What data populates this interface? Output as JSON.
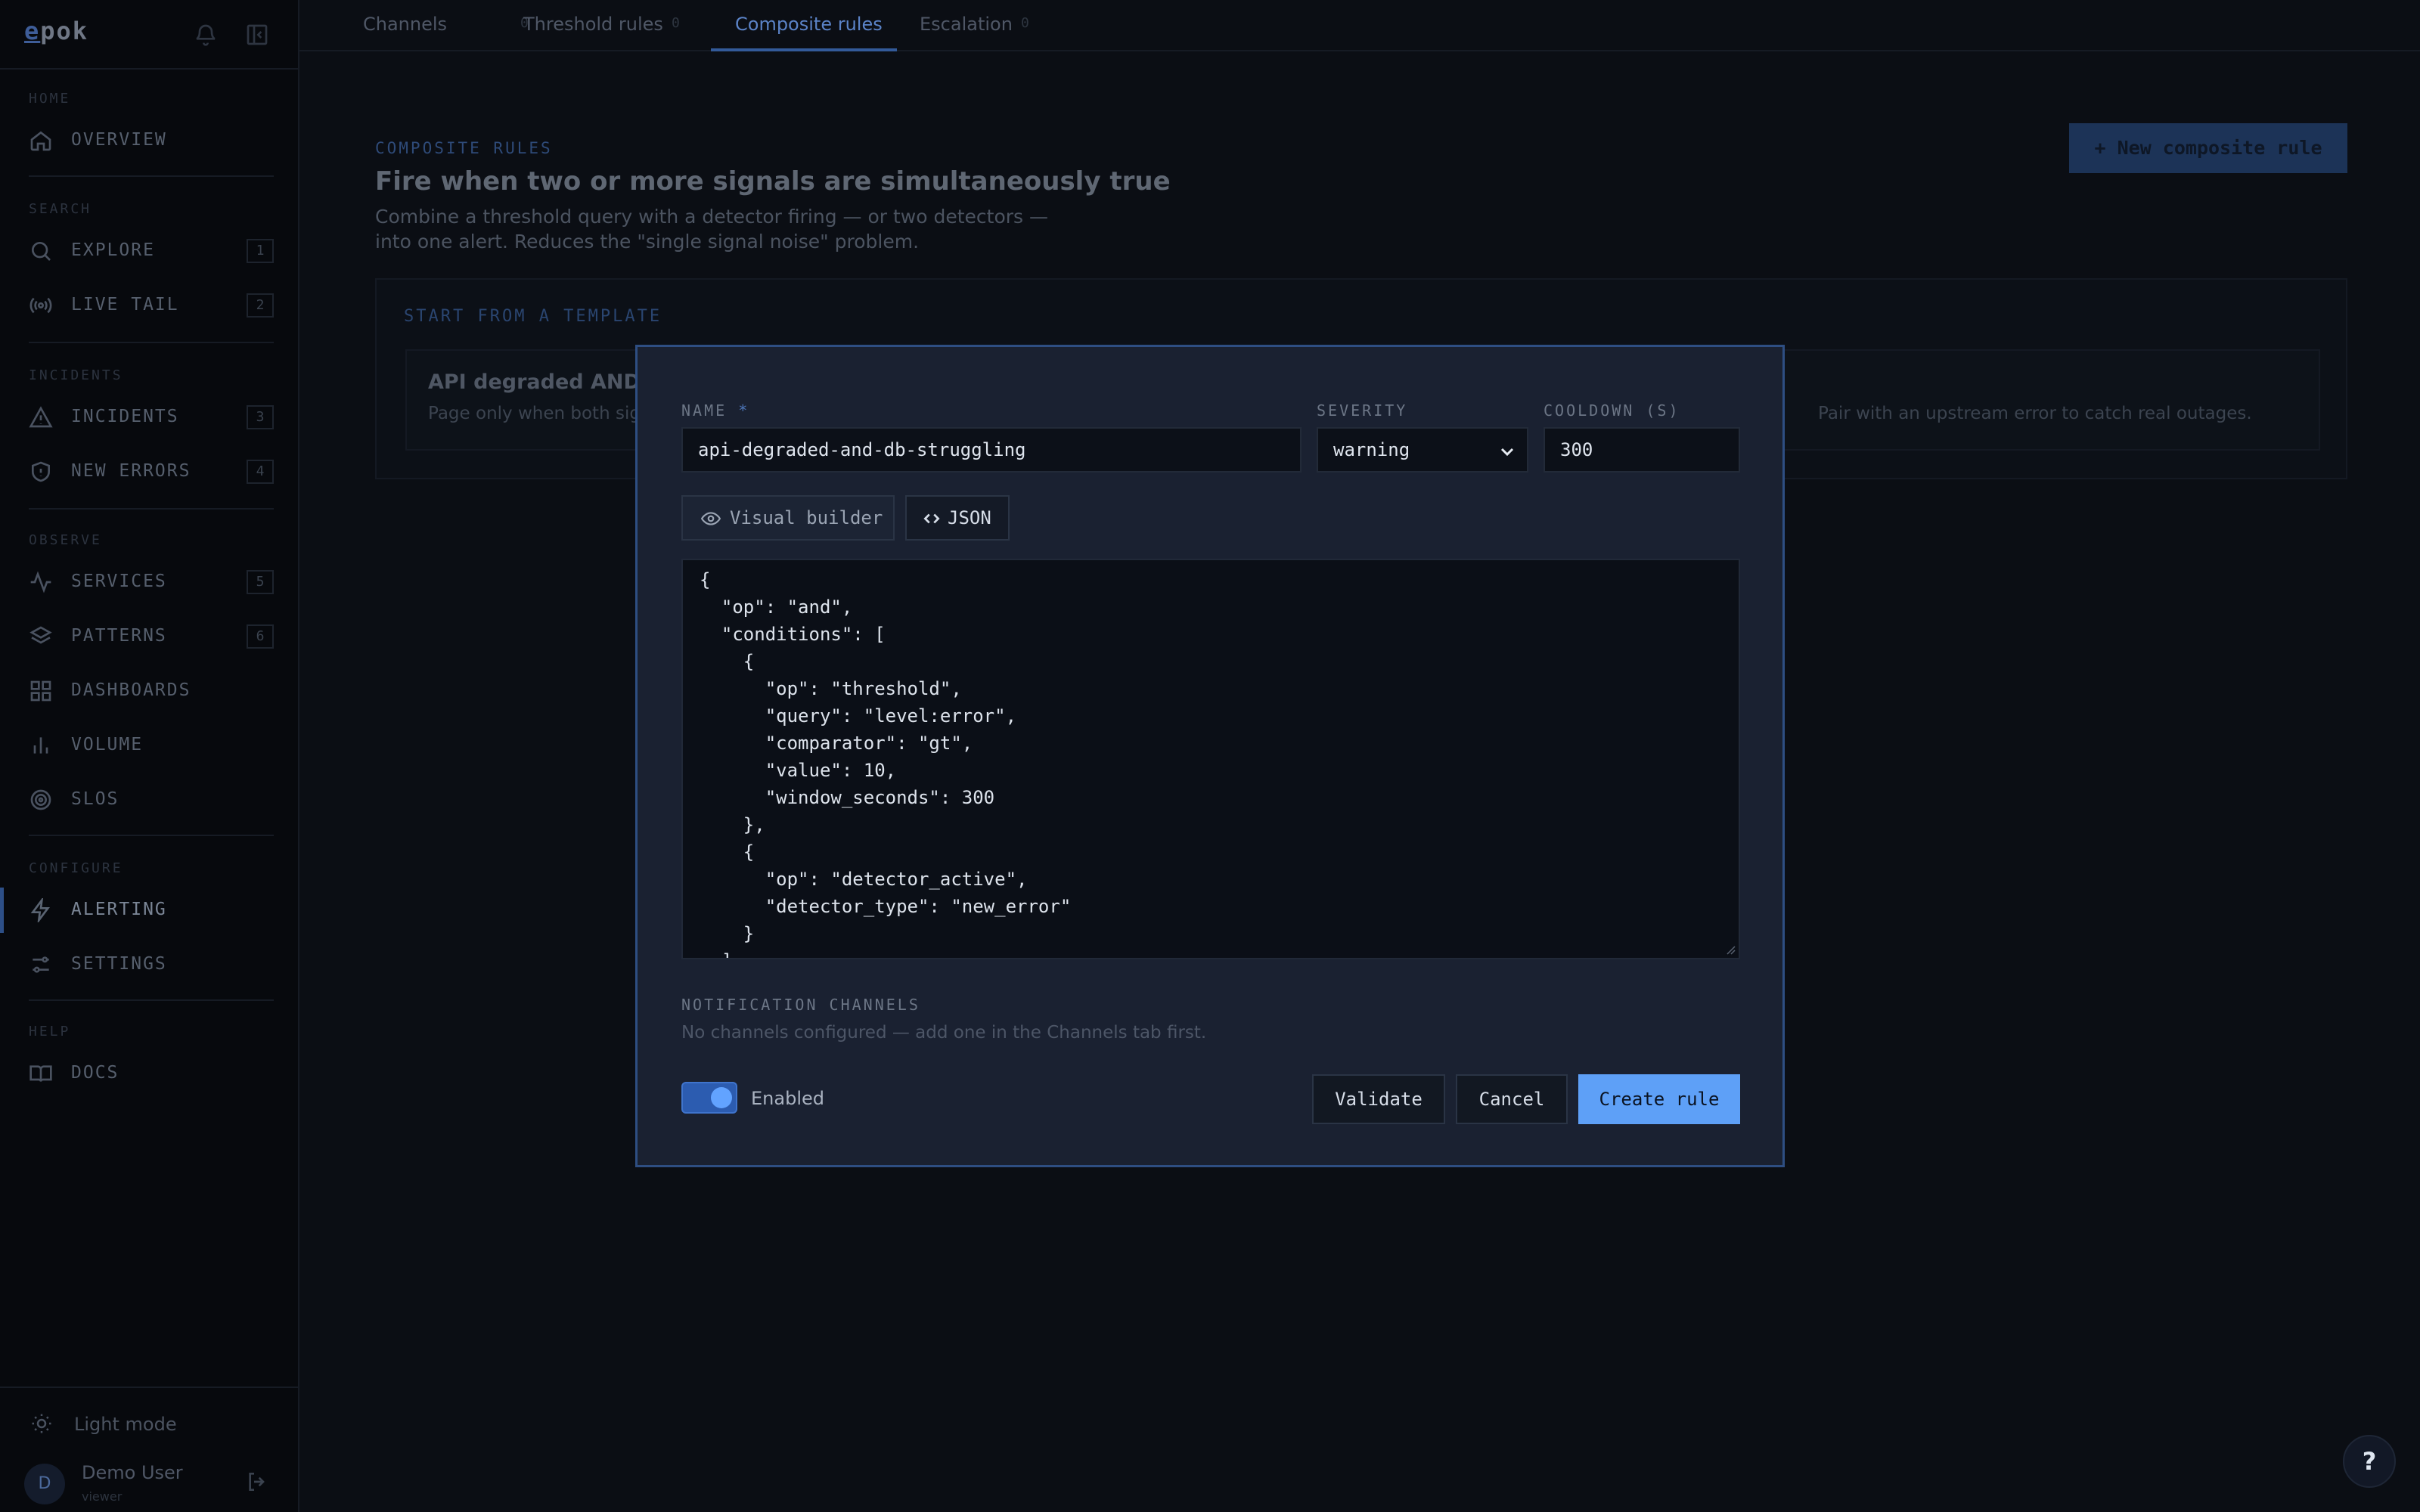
{
  "app": {
    "logo": "epok"
  },
  "sidebar": {
    "sections": [
      {
        "title": "HOME",
        "items": [
          {
            "label": "OVERVIEW",
            "key": ""
          }
        ]
      },
      {
        "title": "SEARCH",
        "items": [
          {
            "label": "EXPLORE",
            "key": "1"
          },
          {
            "label": "LIVE TAIL",
            "key": "2"
          }
        ]
      },
      {
        "title": "INCIDENTS",
        "items": [
          {
            "label": "INCIDENTS",
            "key": "3"
          },
          {
            "label": "NEW ERRORS",
            "key": "4"
          }
        ]
      },
      {
        "title": "OBSERVE",
        "items": [
          {
            "label": "SERVICES",
            "key": "5"
          },
          {
            "label": "PATTERNS",
            "key": "6"
          },
          {
            "label": "DASHBOARDS",
            "key": ""
          },
          {
            "label": "VOLUME",
            "key": ""
          },
          {
            "label": "SLOS",
            "key": ""
          }
        ]
      },
      {
        "title": "CONFIGURE",
        "items": [
          {
            "label": "ALERTING",
            "key": ""
          },
          {
            "label": "SETTINGS",
            "key": ""
          }
        ]
      },
      {
        "title": "HELP",
        "items": [
          {
            "label": "DOCS",
            "key": ""
          }
        ]
      }
    ],
    "footer": {
      "theme_toggle": "Light mode",
      "user_initial": "D",
      "user_name": "Demo User",
      "user_role": "viewer"
    }
  },
  "tabs": [
    {
      "label": "Channels",
      "count": "0"
    },
    {
      "label": "Threshold rules",
      "count": "0"
    },
    {
      "label": "Composite rules",
      "count": ""
    },
    {
      "label": "Escalation",
      "count": "0"
    }
  ],
  "page": {
    "kicker": "COMPOSITE RULES",
    "title": "Fire when two or more signals are simultaneously true",
    "description": "Combine a threshold query with a detector firing — or two detectors — into one alert. Reduces the \"single signal noise\" problem.",
    "new_button": "+ New composite rule",
    "templates": {
      "kicker": "START FROM A TEMPLATE",
      "card_title": "API degraded AND DB",
      "card_desc": "Page only when both signa",
      "card_desc_tail": "Pair with an upstream error to catch real outages."
    }
  },
  "modal": {
    "name_label": "NAME",
    "name_required": "*",
    "name_value": "api-degraded-and-db-struggling",
    "severity_label": "SEVERITY",
    "severity_value": "warning",
    "cooldown_label": "COOLDOWN (S)",
    "cooldown_value": "300",
    "mode_visual": "Visual builder",
    "mode_json": "JSON",
    "json_text": "{\n  \"op\": \"and\",\n  \"conditions\": [\n    {\n      \"op\": \"threshold\",\n      \"query\": \"level:error\",\n      \"comparator\": \"gt\",\n      \"value\": 10,\n      \"window_seconds\": 300\n    },\n    {\n      \"op\": \"detector_active\",\n      \"detector_type\": \"new_error\"\n    }\n  ]\n}",
    "channels_label": "NOTIFICATION CHANNELS",
    "channels_empty": "No channels configured — add one in the Channels tab first.",
    "enabled_label": "Enabled",
    "validate_button": "Validate",
    "cancel_button": "Cancel",
    "create_button": "Create rule"
  },
  "help_button": "?",
  "colors": {
    "accent": "#5ea0f7",
    "modal_border": "#2e4e82",
    "background": "#0b0e14"
  }
}
